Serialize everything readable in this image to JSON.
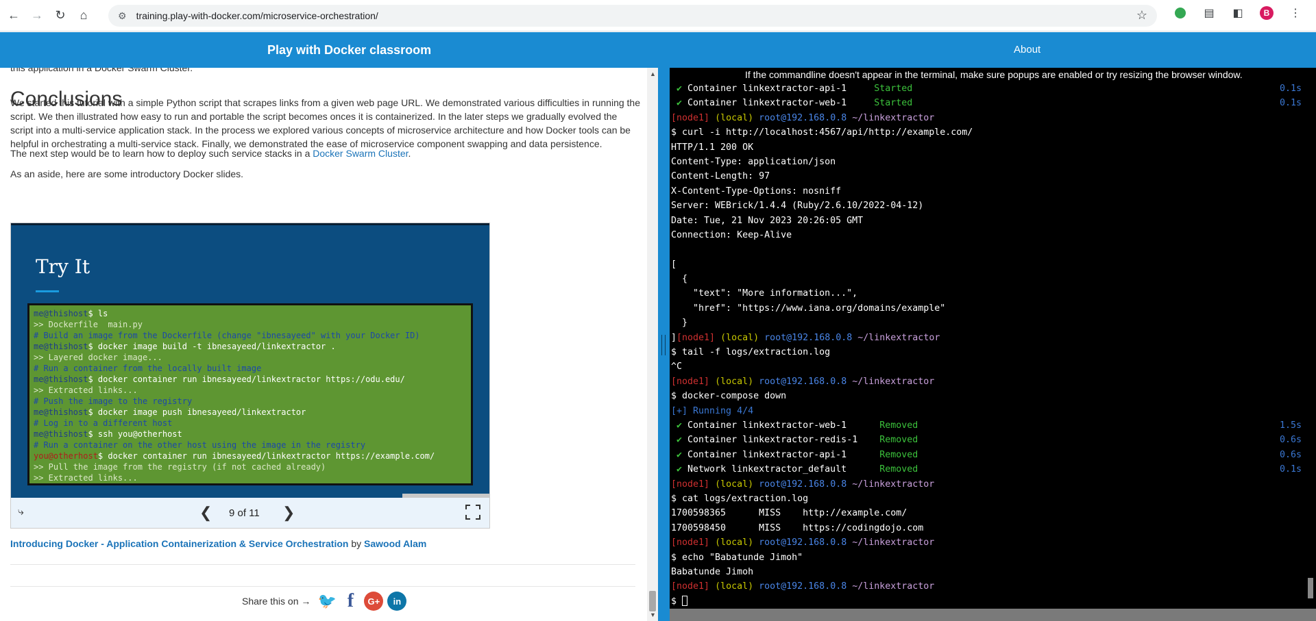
{
  "browser": {
    "url": "training.play-with-docker.com/microservice-orchestration/",
    "avatar_letter": "B"
  },
  "header": {
    "title": "Play with Docker classroom",
    "about": "About"
  },
  "doc": {
    "cut_line": "this application in a Docker Swarm Cluster.",
    "heading": "Conclusions",
    "para1": "We started this tutorial with a simple Python script that scrapes links from a given web page URL. We demonstrated various difficulties in running the script. We then illustrated how easy to run and portable the script becomes onces it is containerized. In the later steps we gradually evolved the script into a multi-service application stack. In the process we explored various concepts of microservice architecture and how Docker tools can be helpful in orchestrating a multi-service stack. Finally, we demonstrated the ease of microservice component swapping and data persistence.",
    "para2_prefix": "The next step would be to learn how to deploy such service stacks in a ",
    "para2_link": "Docker Swarm Cluster",
    "para2_suffix": ".",
    "para3": "As an aside, here are some introductory Docker slides.",
    "slide": {
      "title": "Try It",
      "counter": "9 of 11",
      "progress": 0.818,
      "code": [
        [
          {
            "c": "prompt",
            "t": "me@thishost"
          },
          {
            "c": "cmd",
            "t": "$ ls"
          }
        ],
        [
          {
            "c": "out",
            "t": ">> Dockerfile  main.py"
          }
        ],
        [
          {
            "c": "comment",
            "t": "# Build an image from the Dockerfile (change \"ibnesayeed\" with your Docker ID)"
          }
        ],
        [
          {
            "c": "prompt",
            "t": "me@thishost"
          },
          {
            "c": "cmd",
            "t": "$ docker image build -t ibnesayeed/linkextractor ."
          }
        ],
        [
          {
            "c": "out",
            "t": ">> Layered docker image..."
          }
        ],
        [
          {
            "c": "comment",
            "t": "# Run a container from the locally built image"
          }
        ],
        [
          {
            "c": "prompt",
            "t": "me@thishost"
          },
          {
            "c": "cmd",
            "t": "$ docker container run ibnesayeed/linkextractor https://odu.edu/"
          }
        ],
        [
          {
            "c": "out",
            "t": ">> Extracted links..."
          }
        ],
        [
          {
            "c": "comment",
            "t": "# Push the image to the registry"
          }
        ],
        [
          {
            "c": "prompt",
            "t": "me@thishost"
          },
          {
            "c": "cmd",
            "t": "$ docker image push ibnesayeed/linkextractor"
          }
        ],
        [
          {
            "c": "comment",
            "t": "# Log in to a different host"
          }
        ],
        [
          {
            "c": "prompt",
            "t": "me@thishost"
          },
          {
            "c": "cmd",
            "t": "$ ssh you@otherhost"
          }
        ],
        [
          {
            "c": "comment",
            "t": "# Run a container on the other host using the image in the registry"
          }
        ],
        [
          {
            "c": "other",
            "t": "you@otherhost"
          },
          {
            "c": "cmd",
            "t": "$ docker container run ibnesayeed/linkextractor https://example.com/"
          }
        ],
        [
          {
            "c": "out",
            "t": ">> Pull the image from the registry (if not cached already)"
          }
        ],
        [
          {
            "c": "out",
            "t": ">> Extracted links..."
          }
        ]
      ]
    },
    "caption_link": "Introducing Docker - Application Containerization & Service Orchestration",
    "caption_by": " by ",
    "caption_author": "Sawood Alam",
    "share_text": "Share this on →",
    "share": {
      "twitter": "🐦",
      "facebook": "f",
      "google": "G+",
      "linkedin": "in"
    }
  },
  "terminal": {
    "notice": "If the commandline doesn't appear in the terminal, make sure popups are enabled or try resizing the browser window.",
    "prompt": {
      "node": "[node1]",
      "local": "(local)",
      "root": "root@192.168.0.8",
      "path": "~/linkextractor"
    },
    "lines": [
      {
        "k": "svc",
        "name": "Container linkextractor-api-1 ",
        "status": "Started",
        "time": "0.1s"
      },
      {
        "k": "svc",
        "name": "Container linkextractor-web-1 ",
        "status": "Started",
        "time": "0.1s"
      },
      {
        "k": "prompt"
      },
      {
        "k": "text",
        "t": "$ curl -i http://localhost:4567/api/http://example.com/"
      },
      {
        "k": "text",
        "t": "HTTP/1.1 200 OK"
      },
      {
        "k": "text",
        "t": "Content-Type: application/json"
      },
      {
        "k": "text",
        "t": "Content-Length: 97"
      },
      {
        "k": "text",
        "t": "X-Content-Type-Options: nosniff"
      },
      {
        "k": "text",
        "t": "Server: WEBrick/1.4.4 (Ruby/2.6.10/2022-04-12)"
      },
      {
        "k": "text",
        "t": "Date: Tue, 21 Nov 2023 20:26:05 GMT"
      },
      {
        "k": "text",
        "t": "Connection: Keep-Alive"
      },
      {
        "k": "text",
        "t": ""
      },
      {
        "k": "text",
        "t": "["
      },
      {
        "k": "text",
        "t": "  {"
      },
      {
        "k": "text",
        "t": "    \"text\": \"More information...\","
      },
      {
        "k": "text",
        "t": "    \"href\": \"https://www.iana.org/domains/example\""
      },
      {
        "k": "text",
        "t": "  }"
      },
      {
        "k": "prompt",
        "pre": "]"
      },
      {
        "k": "text",
        "t": "$ tail -f logs/extraction.log"
      },
      {
        "k": "text",
        "t": "^C"
      },
      {
        "k": "prompt"
      },
      {
        "k": "text",
        "t": "$ docker-compose down"
      },
      {
        "k": "running",
        "t": "[+] Running 4/4"
      },
      {
        "k": "svc",
        "name": "Container linkextractor-web-1  ",
        "status": "Removed",
        "time": "1.5s"
      },
      {
        "k": "svc",
        "name": "Container linkextractor-redis-1",
        "status": "Removed",
        "time": "0.6s"
      },
      {
        "k": "svc",
        "name": "Container linkextractor-api-1  ",
        "status": "Removed",
        "time": "0.6s"
      },
      {
        "k": "svc",
        "name": "Network linkextractor_default  ",
        "status": "Removed",
        "time": "0.1s"
      },
      {
        "k": "prompt"
      },
      {
        "k": "text",
        "t": "$ cat logs/extraction.log"
      },
      {
        "k": "text",
        "t": "1700598365      MISS    http://example.com/"
      },
      {
        "k": "text",
        "t": "1700598450      MISS    https://codingdojo.com"
      },
      {
        "k": "prompt"
      },
      {
        "k": "text",
        "t": "$ echo \"Babatunde Jimoh\""
      },
      {
        "k": "text",
        "t": "Babatunde Jimoh"
      },
      {
        "k": "prompt"
      },
      {
        "k": "cursor",
        "t": "$ "
      }
    ]
  }
}
